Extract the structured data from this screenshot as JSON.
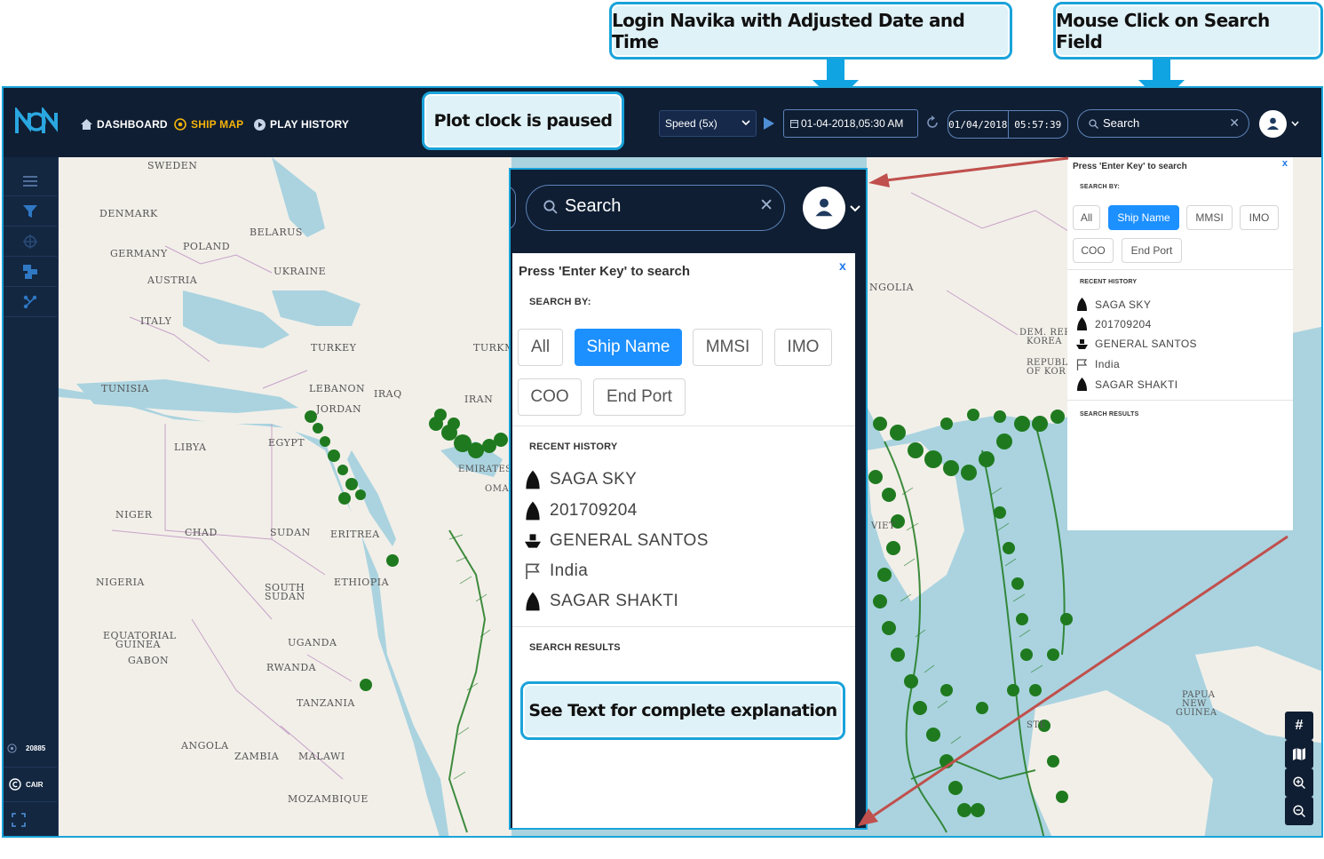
{
  "callouts": {
    "login": "Login Navika with Adjusted Date and Time",
    "mouse_click": "Mouse Click on Search Field",
    "plot_clock": "Plot clock is paused",
    "see_text": "See Text for complete explanation"
  },
  "nav": {
    "dashboard": "DASHBOARD",
    "ship_map": "SHIP MAP",
    "play_history": "PLAY HISTORY"
  },
  "toolbar": {
    "speed": "Speed (5x)",
    "datetime": "01-04-2018,05:30 AM",
    "clock_date": "01/04/2018",
    "clock_time": "05:57:39",
    "search_placeholder": "Search"
  },
  "sidebar": {
    "count": "20885",
    "brand": "CAIR"
  },
  "search_panel": {
    "hint": "Press 'Enter Key' to search",
    "close": "x",
    "search_by_label": "SEARCH BY:",
    "filters": [
      "All",
      "Ship Name",
      "MMSI",
      "IMO",
      "COO",
      "End Port"
    ],
    "active_filter": "Ship Name",
    "recent_label": "RECENT HISTORY",
    "recent": [
      "SAGA SKY",
      "201709204",
      "GENERAL SANTOS",
      "India",
      "SAGAR SHAKTI"
    ],
    "results_label": "SEARCH RESULTS"
  },
  "map_labels": [
    "SWEDEN",
    "DENMARK",
    "BELARUS",
    "GERMANY",
    "POLAND",
    "UKRAINE",
    "AUSTRIA",
    "ITALY",
    "TURKEY",
    "TUNISIA",
    "LEBANON",
    "JORDAN",
    "IRAQ",
    "IRAN",
    "TURKM",
    "LIBYA",
    "EGYPT",
    "EMIRATES",
    "OMA",
    "NIGER",
    "CHAD",
    "SUDAN",
    "ERITREA",
    "NIGERIA",
    "SOUTH",
    "SUDAN",
    "ETHIOPIA",
    "EQUATORIAL",
    "GUINEA",
    "GABON",
    "UGANDA",
    "RWANDA",
    "TANZANIA",
    "ANGOLA",
    "ZAMBIA",
    "MALAWI",
    "MOZAMBIQUE",
    "NGOLIA",
    "DEM. REP",
    "KOREA",
    "REPUBL",
    "OF KOR",
    "VIET",
    "PAPUA",
    "NEW",
    "GUINEA",
    "STE"
  ],
  "colors": {
    "nav_bg": "#0f1e33",
    "accent": "#1d90ff",
    "active_nav": "#f5b30a",
    "callout_border": "#1aa3d9",
    "ship_green": "#1f7a1f",
    "pointer_arrow": "#c0504d"
  }
}
